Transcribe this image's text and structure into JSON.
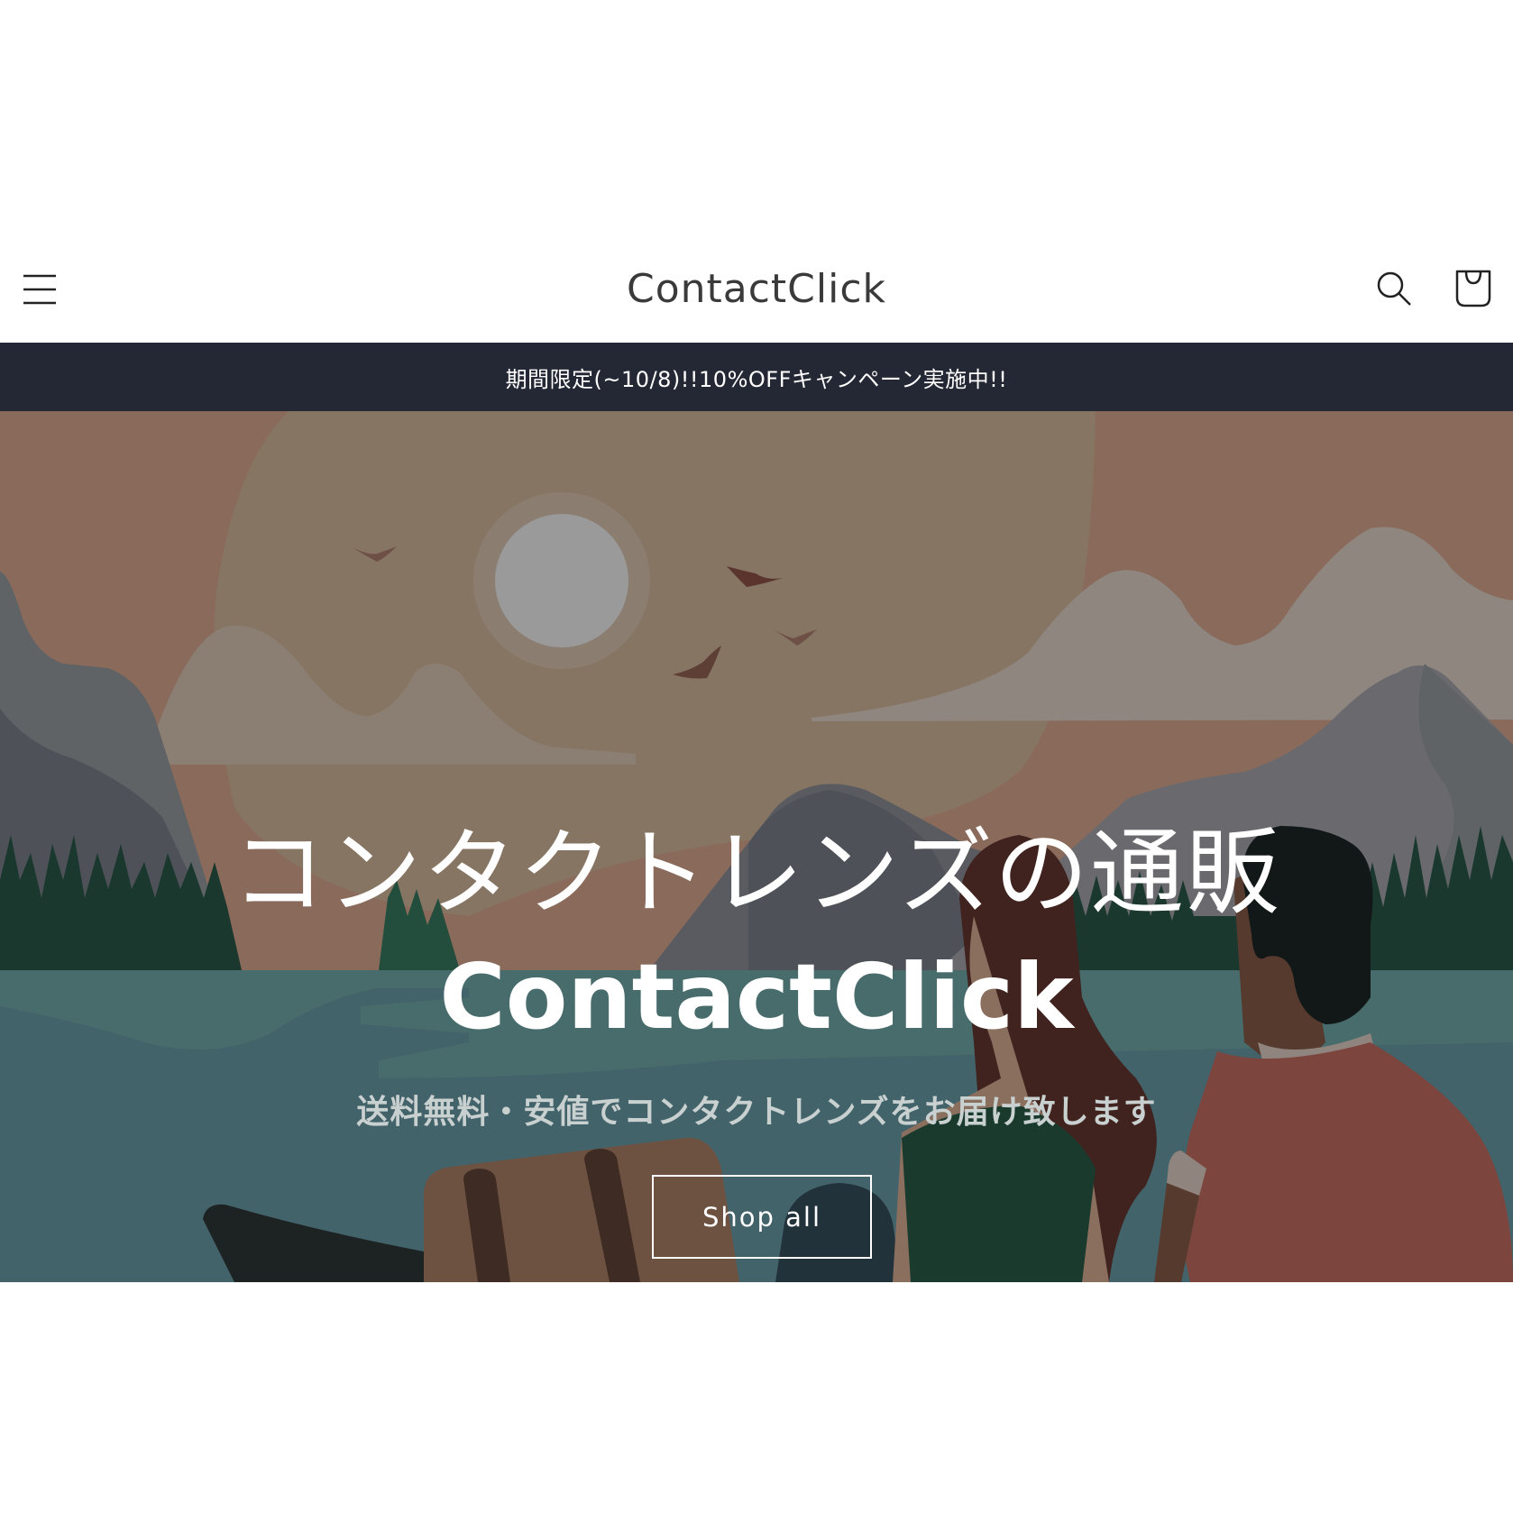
{
  "header": {
    "logo": "ContactClick",
    "icons": {
      "menu": "hamburger-menu-icon",
      "search": "search-icon",
      "cart": "shopping-bag-icon"
    }
  },
  "announcement": {
    "text": "期間限定(~10/8)!!10%OFFキャンペーン実施中!!"
  },
  "hero": {
    "title_jp": "コンタクトレンズの通販",
    "title_en": "ContactClick",
    "subtitle": "送料無料・安値でコンタクトレンズをお届け致します",
    "cta_label": "Shop all",
    "illustration": "lake-sunset-couple-boat-illustration"
  },
  "colors": {
    "announcement_bg": "#242734",
    "text_on_dark": "#ffffff",
    "logo": "#3a3a3a",
    "subtitle": "#c9d0d0"
  }
}
